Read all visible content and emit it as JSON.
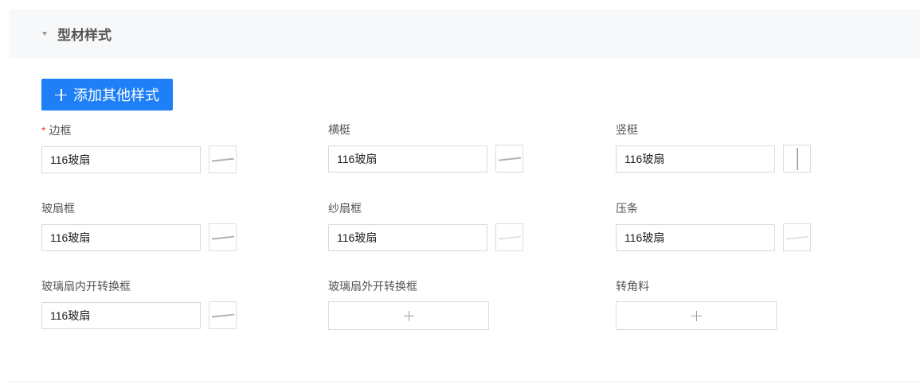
{
  "section": {
    "title": "型材样式"
  },
  "toolbar": {
    "add_label": "添加其他样式"
  },
  "fields": [
    {
      "label": "边框",
      "required": true,
      "value": "116玻扇",
      "thumb": "bar"
    },
    {
      "label": "横梃",
      "required": false,
      "value": "116玻扇",
      "thumb": "bar"
    },
    {
      "label": "竖梃",
      "required": false,
      "value": "116玻扇",
      "thumb": "vertical"
    },
    {
      "label": "玻扇框",
      "required": false,
      "value": "116玻扇",
      "thumb": "bar"
    },
    {
      "label": "纱扇框",
      "required": false,
      "value": "116玻扇",
      "thumb": "light"
    },
    {
      "label": "压条",
      "required": false,
      "value": "116玻扇",
      "thumb": "light"
    },
    {
      "label": "玻璃扇内开转换框",
      "required": false,
      "value": "116玻扇",
      "thumb": "bar"
    },
    {
      "label": "玻璃扇外开转换框",
      "required": false,
      "empty": true
    },
    {
      "label": "转角料",
      "required": false,
      "empty": true
    }
  ],
  "required_mark": "*",
  "colors": {
    "primary": "#1e7ff6",
    "required": "#e8453c",
    "header_bg": "#f7f8fa"
  }
}
